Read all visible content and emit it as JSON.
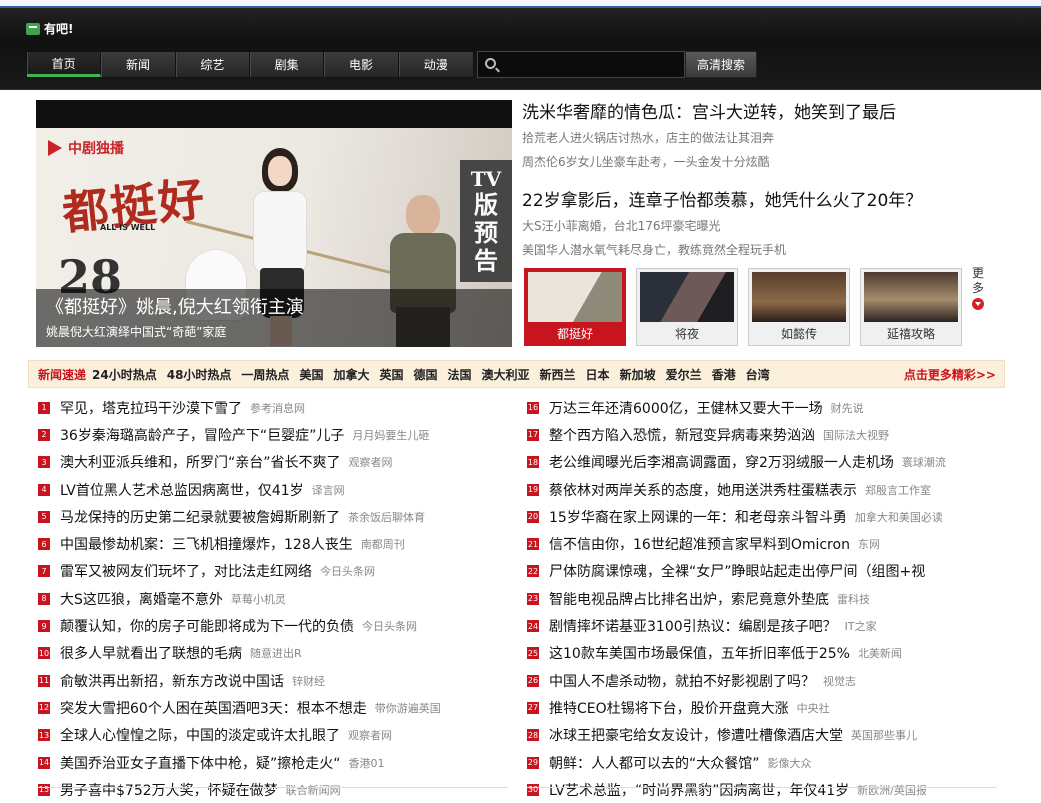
{
  "header": {
    "logo_text": "有吧!",
    "nav": [
      "首页",
      "新闻",
      "综艺",
      "剧集",
      "电影",
      "动漫"
    ],
    "search_button": "高清搜索"
  },
  "hero": {
    "brand": "中剧独播",
    "drama": "都挺好",
    "drama_en": "ALL IS WELL",
    "episode": "28",
    "side_tv": "TV",
    "side_chars": [
      "版",
      "预",
      "告"
    ],
    "title": "《都挺好》姚晨,倪大红领衔主演",
    "subtitle": "姚晨倪大红演绎中国式“奇葩”家庭"
  },
  "side_news": {
    "block1": {
      "head": "洗米华奢靡的情色瓜：宫斗大逆转，她笑到了最后",
      "lines": [
        "拾荒老人进火锅店讨热水，店主的做法让其泪奔",
        "周杰伦6岁女儿坐豪车赴考，一头金发十分炫酷"
      ]
    },
    "block2": {
      "head": "22岁拿影后，连章子怡都羡慕，她凭什么火了20年？",
      "lines": [
        "大S汪小菲离婚，台北176坪豪宅曝光",
        "美国华人潜水氧气耗尽身亡，教练竟然全程玩手机"
      ]
    }
  },
  "thumbs": [
    {
      "label": "都挺好",
      "active": true
    },
    {
      "label": "将夜",
      "active": false
    },
    {
      "label": "如懿传",
      "active": false
    },
    {
      "label": "延禧攻略",
      "active": false
    }
  ],
  "more": {
    "label": "更多"
  },
  "tabbar": {
    "lead": "新闻速递",
    "tabs": [
      "24小时热点",
      "48小时热点",
      "一周热点",
      "美国",
      "加拿大",
      "英国",
      "德国",
      "法国",
      "澳大利亚",
      "新西兰",
      "日本",
      "新加坡",
      "爱尔兰",
      "香港",
      "台湾"
    ],
    "more": "点击更多精彩>>"
  },
  "news_left": [
    {
      "n": "1",
      "title": "罕见，塔克拉玛干沙漠下雪了",
      "src": "参考消息网"
    },
    {
      "n": "2",
      "title": "36岁秦海璐高龄产子，冒险产下“巨婴症”儿子",
      "src": "月月妈要生儿砸"
    },
    {
      "n": "3",
      "title": "澳大利亚派兵维和，所罗门“亲台”省长不爽了",
      "src": "观察者网"
    },
    {
      "n": "4",
      "title": "LV首位黑人艺术总监因病离世，仅41岁",
      "src": "译言网"
    },
    {
      "n": "5",
      "title": "马龙保持的历史第二纪录就要被詹姆斯刷新了",
      "src": "茶余饭后聊体育"
    },
    {
      "n": "6",
      "title": "中国最惨劫机案：三飞机相撞爆炸，128人丧生",
      "src": "南都周刊"
    },
    {
      "n": "7",
      "title": "雷军又被网友们玩坏了，对比法走红网络",
      "src": "今日头条网"
    },
    {
      "n": "8",
      "title": "大S这匹狼，离婚毫不意外",
      "src": "草莓小机灵"
    },
    {
      "n": "9",
      "title": "颠覆认知，你的房子可能即将成为下一代的负债",
      "src": "今日头条网"
    },
    {
      "n": "10",
      "title": "很多人早就看出了联想的毛病",
      "src": "随意进出R"
    },
    {
      "n": "11",
      "title": "俞敏洪再出新招，新东方改说中国话",
      "src": "锌财经"
    },
    {
      "n": "12",
      "title": "突发大雪把60个人困在英国酒吧3天：根本不想走",
      "src": "带你游遍英国"
    },
    {
      "n": "13",
      "title": "全球人心惶惶之际，中国的淡定或许太扎眼了",
      "src": "观察者网"
    },
    {
      "n": "14",
      "title": "美国乔治亚女子直播下体中枪，疑”擦枪走火“",
      "src": "香港01"
    },
    {
      "n": "15",
      "title": "男子喜中$752万大奖，怀疑在做梦",
      "src": "联合新闻网"
    }
  ],
  "news_right": [
    {
      "n": "16",
      "title": "万达三年还清6000亿，王健林又要大干一场",
      "src": "财先说"
    },
    {
      "n": "17",
      "title": "整个西方陷入恐慌，新冠变异病毒来势汹汹",
      "src": "国际法大视野"
    },
    {
      "n": "18",
      "title": "老公维闻曝光后李湘高调露面，穿2万羽绒服一人走机场",
      "src": "寰球潮流"
    },
    {
      "n": "19",
      "title": "蔡依林对两岸关系的态度，她用送洪秀柱蛋糕表示",
      "src": "郑殷言工作室"
    },
    {
      "n": "20",
      "title": "15岁华裔在家上网课的一年：和老母亲斗智斗勇",
      "src": "加拿大和美国必读"
    },
    {
      "n": "21",
      "title": "信不信由你，16世纪超准预言家早料到Omicron",
      "src": "东网"
    },
    {
      "n": "22",
      "title": "尸体防腐课惊魂，全裸“女尸”睁眼站起走出停尸间（组图+视",
      "src": ""
    },
    {
      "n": "23",
      "title": "智能电视品牌占比排名出炉，索尼竟意外垫底",
      "src": "雷科技"
    },
    {
      "n": "24",
      "title": "剧情摔坏诺基亚3100引热议：编剧是孩子吧？",
      "src": "IT之家"
    },
    {
      "n": "25",
      "title": "这10款车美国市场最保值，五年折旧率低于25%",
      "src": "北美新闻"
    },
    {
      "n": "26",
      "title": "中国人不虐杀动物，就拍不好影视剧了吗？",
      "src": "视觉志"
    },
    {
      "n": "27",
      "title": "推特CEO杜锡将下台，股价开盘竟大涨",
      "src": "中央社"
    },
    {
      "n": "28",
      "title": "冰球王把豪宅给女友设计，惨遭吐槽像酒店大堂",
      "src": "英国那些事儿"
    },
    {
      "n": "29",
      "title": "朝鲜：人人都可以去的“大众餐馆”",
      "src": "影像大众"
    },
    {
      "n": "30",
      "title": "LV艺术总监，“时尚界黑豹”因病离世，年仅41岁",
      "src": "新欧洲/英国报"
    }
  ],
  "colors": {
    "accent_red": "#c8141e",
    "nav_active": "#3fb34f",
    "tabbar_bg": "#fbf0dc"
  }
}
